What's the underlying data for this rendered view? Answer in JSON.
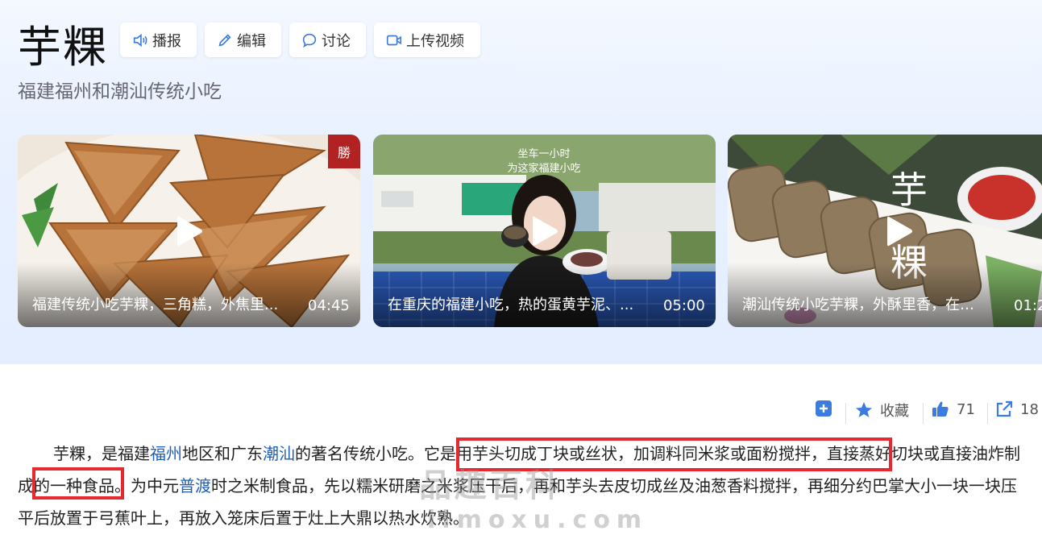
{
  "header": {
    "title": "芋粿",
    "subtitle": "福建福州和潮汕传统小吃",
    "buttons": [
      {
        "label": "播报",
        "icon": "speaker-icon"
      },
      {
        "label": "编辑",
        "icon": "pencil-icon"
      },
      {
        "label": "讨论",
        "icon": "chat-bubble-icon"
      },
      {
        "label": "上传视频",
        "icon": "video-camera-icon"
      }
    ]
  },
  "videos": [
    {
      "caption": "福建传统小吃芋粿，三角糕，外焦里...",
      "duration": "04:45",
      "overlay": ""
    },
    {
      "caption": "在重庆的福建小吃，热的蛋黄芋泥、...",
      "duration": "05:00",
      "overlay_line1": "坐车一小时",
      "overlay_line2": "为这家福建小吃"
    },
    {
      "caption": "潮汕传统小吃芋粿，外酥里香，在家...",
      "duration": "01:2",
      "overlay_chars": [
        "芋",
        "粿"
      ]
    }
  ],
  "toolbar": {
    "add_icon": "plus-square-icon",
    "favorite_label": "收藏",
    "like_count": "71",
    "share_count": "18"
  },
  "article": {
    "p1_a": "芋粿，是福建",
    "link_fuzhou": "福州",
    "p1_b": "地区和广东",
    "link_chaoshan": "潮汕",
    "p1_c": "的著名传统小吃。",
    "p1_d": "它是用芋头切成丁块或丝状，加调料同米浆或面粉搅拌，",
    "p1_e": "直接蒸好切块或",
    "p1_f": "直接油炸制",
    "p1_g": "成的一种食品。为中元",
    "link_pudu": "普渡",
    "p1_h": "时之米制食品，先以糯米研磨之米浆压干后，再和芋头去皮切成丝及油葱香料搅拌，再细分约巴掌大小一块一块压平后放置于弓蕉叶上，再放入笼床后置于灶上大鼎以热水炊熟。"
  },
  "watermark": {
    "line1": "品趣百科",
    "line2": "ilmoxu.com"
  },
  "colors": {
    "highlight_box": "#e5292f",
    "link": "#1d5fb8",
    "accent_blue": "#3c7be0"
  }
}
